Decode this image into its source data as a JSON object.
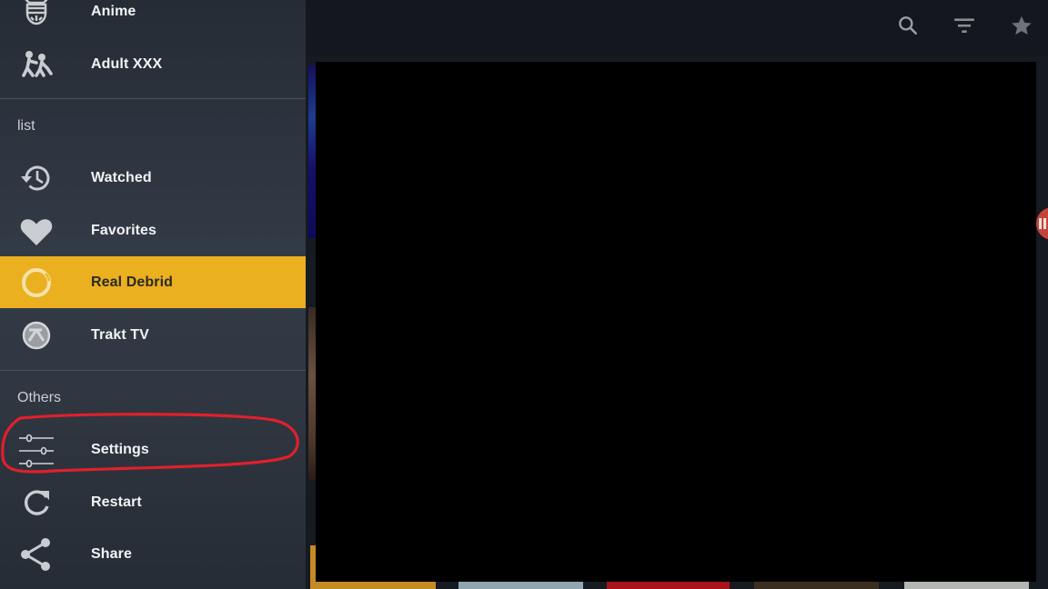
{
  "toolbar": {
    "icons": [
      "search-icon",
      "filter-icon",
      "star-icon"
    ]
  },
  "drawer": {
    "top_items": [
      {
        "label": "Anime",
        "icon": "anime-mask-icon"
      },
      {
        "label": "Adult XXX",
        "icon": "wrestling-icon"
      }
    ],
    "list_section": {
      "title": "list",
      "items": [
        {
          "label": "Watched",
          "icon": "history-icon"
        },
        {
          "label": "Favorites",
          "icon": "heart-icon"
        },
        {
          "label": "Real Debrid",
          "icon": "real-debrid-icon",
          "active": true
        },
        {
          "label": "Trakt TV",
          "icon": "trakt-icon"
        }
      ]
    },
    "others_section": {
      "title": "Others",
      "items": [
        {
          "label": "Settings",
          "icon": "sliders-icon",
          "annotated": true
        },
        {
          "label": "Restart",
          "icon": "restart-icon"
        },
        {
          "label": "Share",
          "icon": "share-icon"
        }
      ]
    }
  },
  "colors": {
    "accent": "#eab020",
    "drawer_bg": "#2f3640",
    "annotation": "#e0202c",
    "overlay": "#000000"
  }
}
